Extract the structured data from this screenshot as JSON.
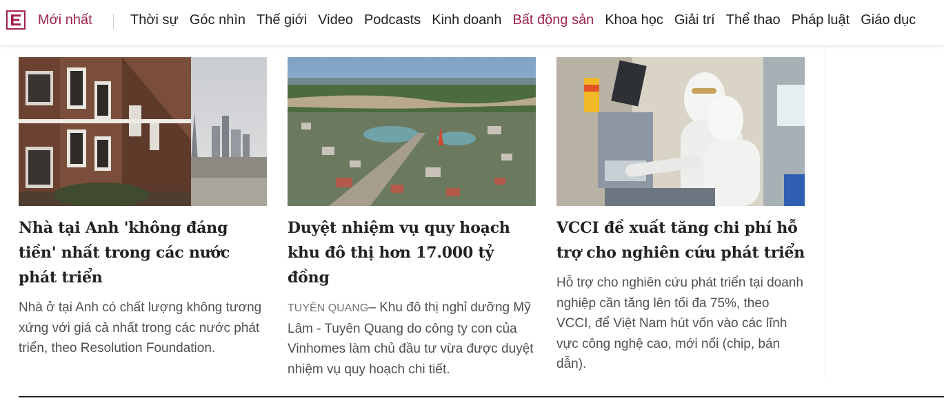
{
  "nav": {
    "logo_icon": "vnexpress-e-logo-icon",
    "newest": "Mới nhất",
    "items": [
      {
        "label": "Thời sự"
      },
      {
        "label": "Góc nhìn"
      },
      {
        "label": "Thế giới"
      },
      {
        "label": "Video"
      },
      {
        "label": "Podcasts"
      },
      {
        "label": "Kinh doanh"
      },
      {
        "label": "Bất động sản",
        "active": true
      },
      {
        "label": "Khoa học"
      },
      {
        "label": "Giải trí"
      },
      {
        "label": "Thể thao"
      },
      {
        "label": "Pháp luật"
      },
      {
        "label": "Giáo dục"
      }
    ]
  },
  "colors": {
    "brand": "#9f224e",
    "text": "#222222",
    "desc": "#4f4f4f",
    "location": "#757575"
  },
  "articles": [
    {
      "image": "london-terraced-houses-skyline-photo",
      "title": "Nhà tại Anh 'không đáng tiền' nhất trong các nước phát triển",
      "description": "Nhà ở tại Anh có chất lượng không tương xứng với giá cả nhất trong các nước phát triển, theo Resolution Foundation."
    },
    {
      "image": "tuyen-quang-city-aerial-photo",
      "title": "Duyệt nhiệm vụ quy hoạch khu đô thị hơn 17.000 tỷ đồng",
      "location": "TUYÊN QUANG",
      "description": "– Khu đô thị nghỉ dưỡng Mỹ Lâm - Tuyên Quang do công ty con của Vinhomes làm chủ đầu tư vừa được duyệt nhiệm vụ quy hoạch chi tiết."
    },
    {
      "image": "cleanroom-chip-workers-photo",
      "title": "VCCI đề xuất tăng chi phí hỗ trợ cho nghiên cứu phát triển",
      "description": "Hỗ trợ cho nghiên cứu phát triển tại doanh nghiệp cần tăng lên tối đa 75%, theo VCCI, để Việt Nam hút vốn vào các lĩnh vực công nghệ cao, mới nổi (chip, bán dẫn)."
    }
  ]
}
